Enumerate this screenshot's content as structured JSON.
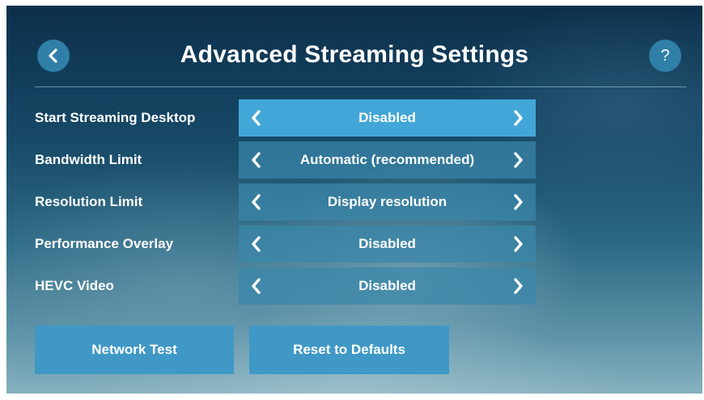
{
  "header": {
    "title": "Advanced Streaming Settings",
    "help_label": "?",
    "back_icon": "chevron-left-icon"
  },
  "settings": [
    {
      "label": "Start Streaming Desktop",
      "value": "Disabled",
      "focused": true
    },
    {
      "label": "Bandwidth Limit",
      "value": "Automatic (recommended)",
      "focused": false
    },
    {
      "label": "Resolution Limit",
      "value": "Display resolution",
      "focused": false
    },
    {
      "label": "Performance Overlay",
      "value": "Disabled",
      "focused": false
    },
    {
      "label": "HEVC Video",
      "value": "Disabled",
      "focused": false
    }
  ],
  "actions": {
    "network_test": "Network Test",
    "reset_defaults": "Reset to Defaults"
  },
  "colors": {
    "accent": "#42a6d8",
    "selector": "#3a87aa",
    "button": "#3f98c6",
    "text": "#ffffff"
  }
}
